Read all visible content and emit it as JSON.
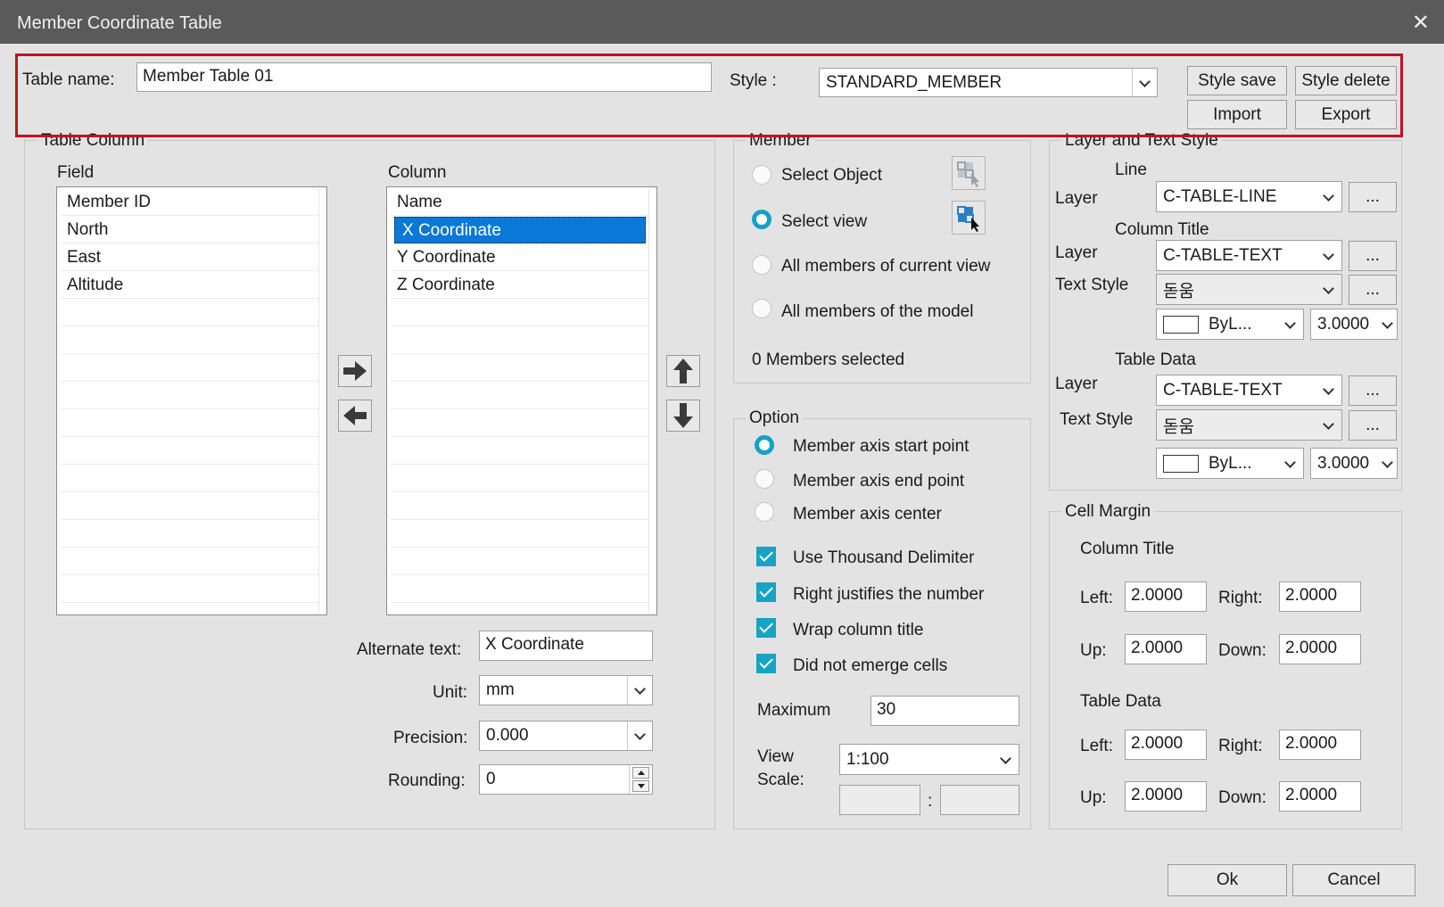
{
  "window": {
    "title": "Member Coordinate Table",
    "close_glyph": "✕"
  },
  "header": {
    "table_name_label": "Table name:",
    "table_name_value": "Member Table 01",
    "style_label": "Style :",
    "style_value": "STANDARD_MEMBER",
    "style_save": "Style save",
    "style_delete": "Style delete",
    "import": "Import",
    "export": "Export"
  },
  "table_column": {
    "title": "Table Column",
    "field_label": "Field",
    "column_label": "Column",
    "fields": [
      "Member ID",
      "North",
      "East",
      "Altitude"
    ],
    "columns": [
      "Name",
      "X Coordinate",
      "Y Coordinate",
      "Z Coordinate"
    ],
    "selected_column": "X Coordinate",
    "alternate_text_label": "Alternate text:",
    "alternate_text_value": "X Coordinate",
    "unit_label": "Unit:",
    "unit_value": "mm",
    "precision_label": "Precision:",
    "precision_value": "0.000",
    "rounding_label": "Rounding:",
    "rounding_value": "0"
  },
  "member": {
    "title": "Member",
    "select_object": "Select Object",
    "select_view": "Select view",
    "all_current_view": "All members of current view",
    "all_model": "All members of the model",
    "selected_count": "0 Members selected",
    "selected_option": "Select view"
  },
  "option": {
    "title": "Option",
    "start_point": "Member axis start point",
    "end_point": "Member axis end point",
    "center": "Member axis center",
    "selected_point": "Member axis start point",
    "use_thousand": "Use Thousand Delimiter",
    "right_justify": "Right justifies the number",
    "wrap_title": "Wrap column title",
    "did_not_emerge": "Did not emerge cells",
    "maximum_label": "Maximum",
    "maximum_value": "30",
    "view_scale_label_1": "View",
    "view_scale_label_2": "Scale:",
    "view_scale_value": "1:100",
    "scale_colon": ":"
  },
  "layer_text": {
    "title": "Layer and Text Style",
    "line_header": "Line",
    "column_title_header": "Column Title",
    "table_data_header": "Table Data",
    "layer_label": "Layer",
    "text_style_label": "Text Style",
    "line_layer": "C-TABLE-LINE",
    "col_layer": "C-TABLE-TEXT",
    "col_text_style": "돋움",
    "col_color": "ByL...",
    "col_height": "3.0000",
    "data_layer": "C-TABLE-TEXT",
    "data_text_style": "돋움",
    "data_color": "ByL...",
    "data_height": "3.0000",
    "browse": "..."
  },
  "cell_margin": {
    "title": "Cell Margin",
    "column_title_header": "Column Title",
    "table_data_header": "Table Data",
    "left_label": "Left:",
    "right_label": "Right:",
    "up_label": "Up:",
    "down_label": "Down:",
    "ct_left": "2.0000",
    "ct_right": "2.0000",
    "ct_up": "2.0000",
    "ct_down": "2.0000",
    "td_left": "2.0000",
    "td_right": "2.0000",
    "td_up": "2.0000",
    "td_down": "2.0000"
  },
  "footer": {
    "ok": "Ok",
    "cancel": "Cancel"
  },
  "colors": {
    "selection": "#0a78d7",
    "check_accent": "#16a4c6",
    "highlight_border": "#c1121f",
    "titlebar": "#5a5a5a"
  }
}
